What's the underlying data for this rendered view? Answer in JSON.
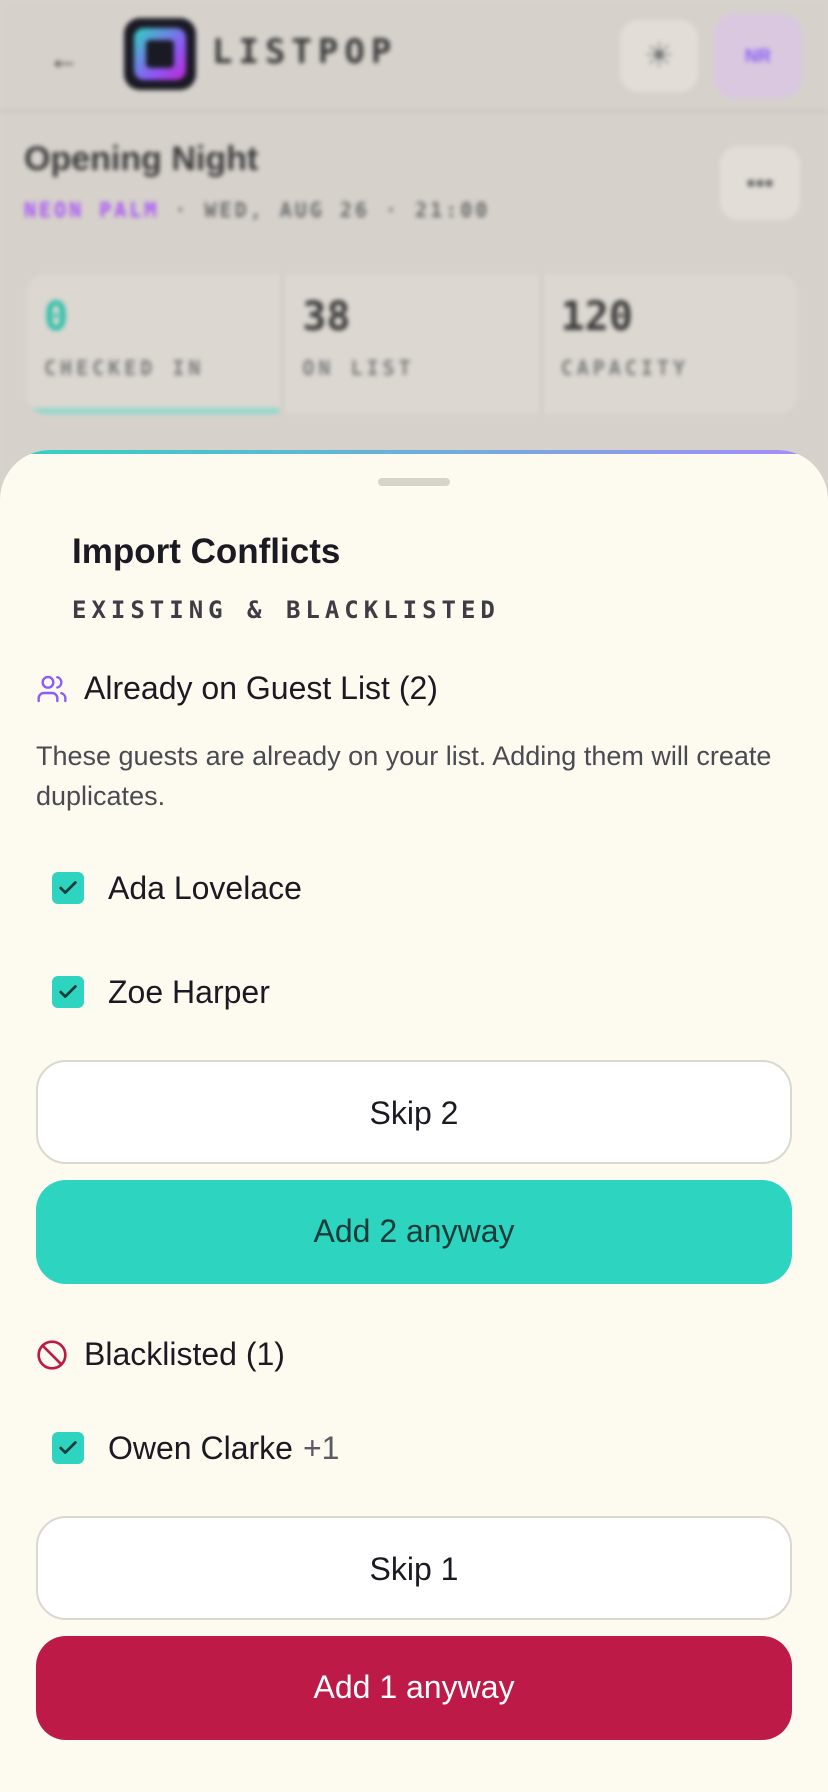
{
  "app": {
    "brand": "LISTPOP",
    "back_glyph": "←",
    "theme_glyph": "☀",
    "avatar_initials": "NR",
    "more_glyph": "•••"
  },
  "event": {
    "title": "Opening Night",
    "venue": "NEON PALM",
    "separator": "·",
    "date": "WED, AUG 26",
    "time": "21:00"
  },
  "stats": [
    {
      "value": "0",
      "label": "CHECKED IN",
      "progress": 0.32
    },
    {
      "value": "38",
      "label": "ON LIST"
    },
    {
      "value": "120",
      "label": "CAPACITY"
    }
  ],
  "sheet": {
    "title": "Import Conflicts",
    "subtitle": "EXISTING & BLACKLISTED"
  },
  "existing": {
    "icon": "users-icon",
    "title": "Already on Guest List (2)",
    "description": "These guests are already on your list. Adding them will create duplicates.",
    "guests": [
      {
        "name": "Ada Lovelace",
        "checked": true
      },
      {
        "name": "Zoe Harper",
        "checked": true
      }
    ],
    "skip_label": "Skip 2",
    "add_label": "Add 2 anyway"
  },
  "blacklisted": {
    "icon": "ban-icon",
    "title": "Blacklisted (1)",
    "guests": [
      {
        "name": "Owen Clarke",
        "plus": "+1",
        "checked": true
      }
    ],
    "skip_label": "Skip 1",
    "add_label": "Add 1 anyway"
  },
  "colors": {
    "accent_teal": "#2dd4bf",
    "danger": "#be1a48",
    "purple": "#8b5cf6",
    "sheet_bg": "#fdfaf0"
  }
}
